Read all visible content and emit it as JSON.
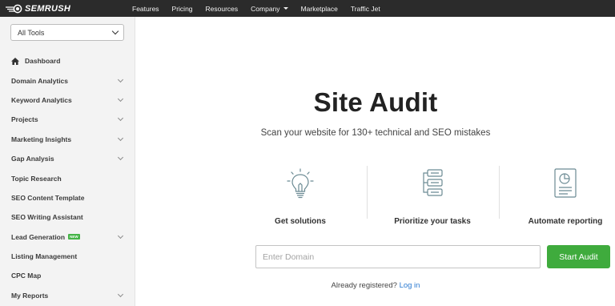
{
  "topbar": {
    "logo_text": "semrush",
    "nav": [
      {
        "label": "Features",
        "caret": false
      },
      {
        "label": "Pricing",
        "caret": false
      },
      {
        "label": "Resources",
        "caret": false
      },
      {
        "label": "Company",
        "caret": true
      },
      {
        "label": "Marketplace",
        "caret": false
      },
      {
        "label": "Traffic Jet",
        "caret": false
      }
    ]
  },
  "sidebar": {
    "tools_select": "All Tools",
    "items": [
      {
        "label": "Dashboard",
        "icon": "home-icon",
        "expandable": false
      },
      {
        "label": "Domain Analytics",
        "expandable": true
      },
      {
        "label": "Keyword Analytics",
        "expandable": true
      },
      {
        "label": "Projects",
        "expandable": true
      },
      {
        "label": "Marketing Insights",
        "expandable": true
      },
      {
        "label": "Gap Analysis",
        "expandable": true
      },
      {
        "label": "Topic Research",
        "expandable": false
      },
      {
        "label": "SEO Content Template",
        "expandable": false
      },
      {
        "label": "SEO Writing Assistant",
        "expandable": false
      },
      {
        "label": "Lead Generation",
        "expandable": true,
        "badge": "new"
      },
      {
        "label": "Listing Management",
        "expandable": false
      },
      {
        "label": "CPC Map",
        "expandable": false
      },
      {
        "label": "My Reports",
        "expandable": true
      }
    ]
  },
  "main": {
    "title": "Site Audit",
    "subtitle": "Scan your website for 130+ technical and SEO mistakes",
    "features": [
      {
        "label": "Get solutions",
        "icon": "lightbulb-icon"
      },
      {
        "label": "Prioritize your tasks",
        "icon": "task-list-icon"
      },
      {
        "label": "Automate reporting",
        "icon": "report-chart-icon"
      }
    ],
    "domain_input": {
      "placeholder": "Enter Domain",
      "value": ""
    },
    "start_button": "Start Audit",
    "login_prompt": "Already registered?",
    "login_link": "Log in"
  },
  "colors": {
    "topbar_bg": "#2b2b2b",
    "sidebar_bg": "#f3f3f3",
    "button_green": "#3fab3d",
    "link_blue": "#2b7ad1",
    "badge_green": "#45b447"
  }
}
